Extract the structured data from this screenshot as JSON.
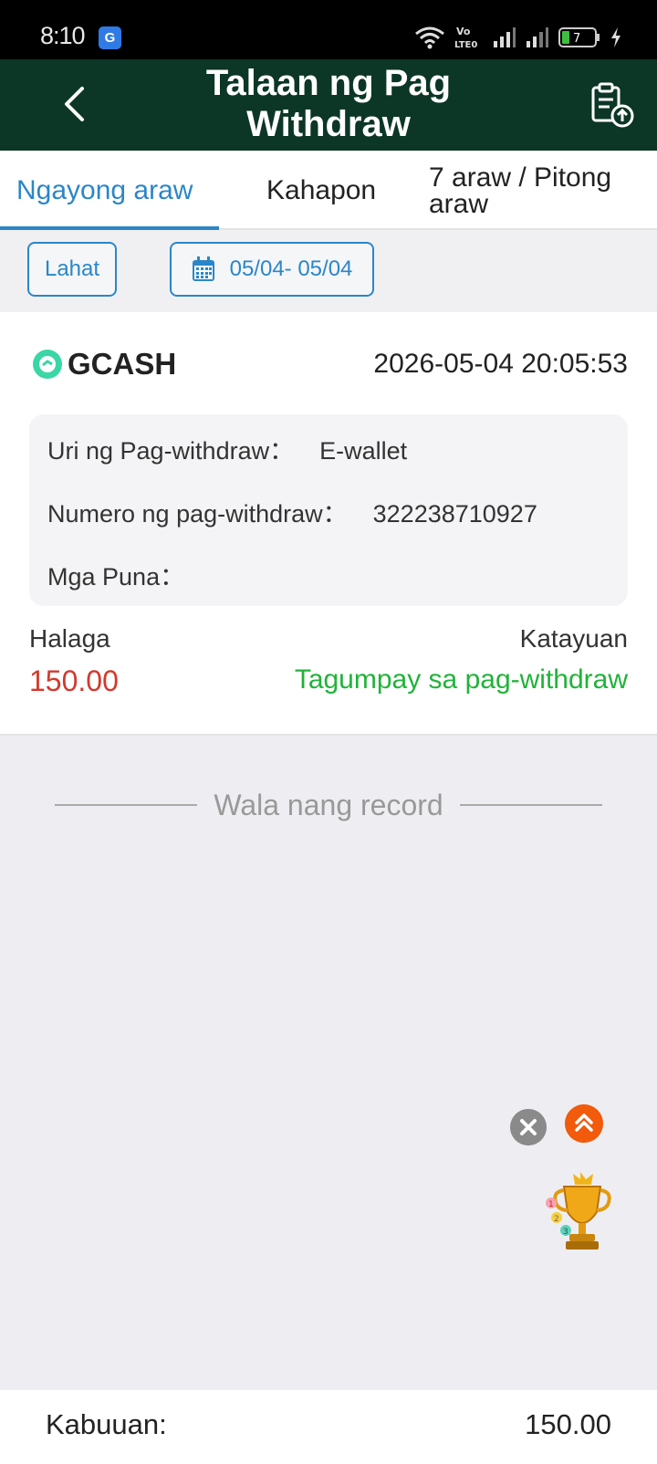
{
  "statusbar": {
    "time": "8:10",
    "app_icon_letter": "G",
    "battery": "7"
  },
  "header": {
    "title": "Talaan ng Pag Withdraw",
    "back_icon": "chevron-left-icon",
    "action_icon": "clipboard-upload-icon"
  },
  "tabs": [
    {
      "label": "Ngayong araw",
      "active": true
    },
    {
      "label": "Kahapon",
      "active": false
    },
    {
      "label": "7 araw / Pitong araw",
      "active": false
    }
  ],
  "filters": {
    "all_label": "Lahat",
    "date_range": "05/04- 05/04"
  },
  "record": {
    "provider": "GCASH",
    "datetime": "2026-05-04 20:05:53",
    "type_label": "Uri ng Pag-withdraw：",
    "type_value": "E-wallet",
    "number_label": "Numero ng pag-withdraw：",
    "number_value": "322238710927",
    "remarks_label": "Mga Puna：",
    "remarks_value": "",
    "amount_label": "Halaga",
    "amount_value": "150.00",
    "status_label": "Katayuan",
    "status_value": "Tagumpay sa pag-withdraw"
  },
  "no_more": "Wala nang record",
  "footer": {
    "total_label": "Kabuuan:",
    "total_value": "150.00"
  },
  "colors": {
    "header_bg": "#0c3626",
    "accent": "#2b86c8",
    "amount": "#d23a2c",
    "success": "#21b339"
  }
}
